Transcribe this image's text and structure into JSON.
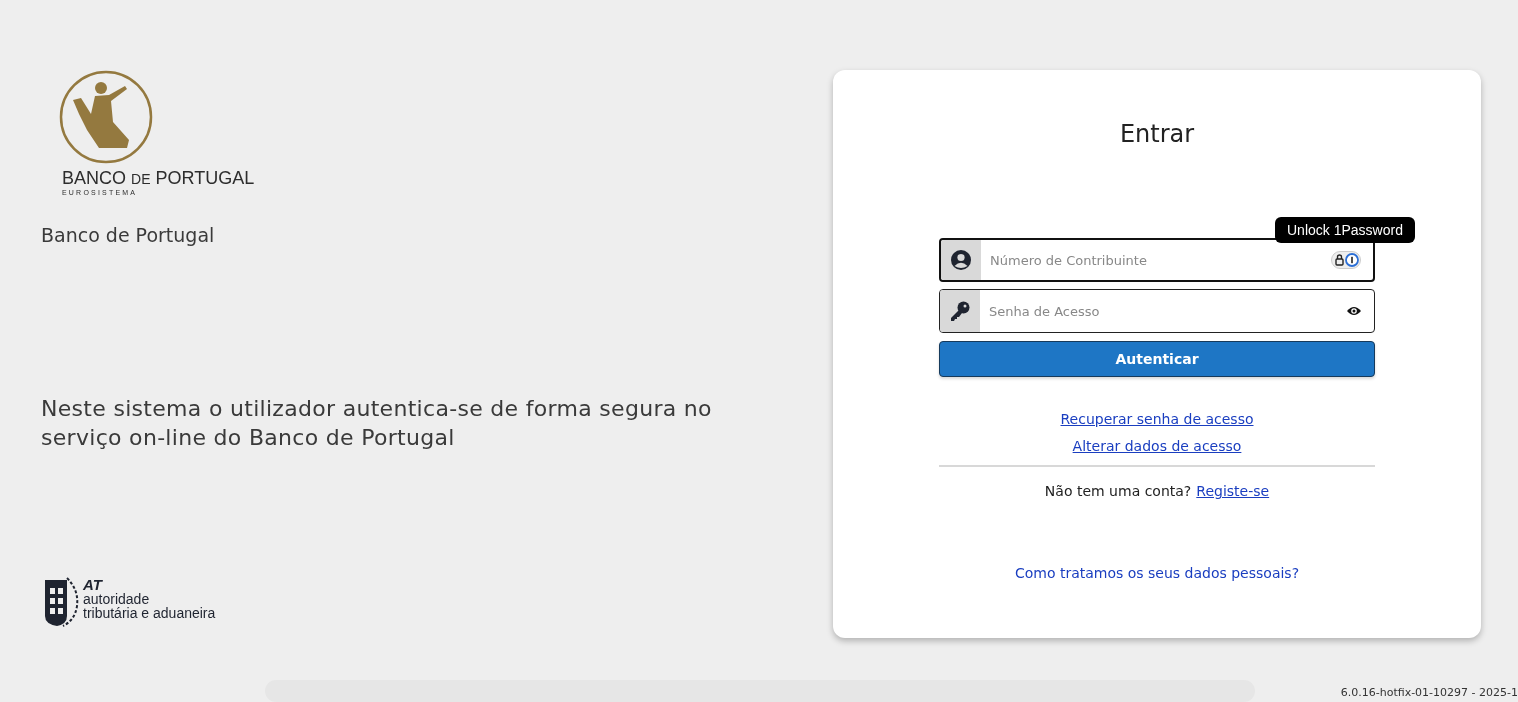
{
  "brand": {
    "logo_word_1": "BANCO",
    "logo_word_2": "DE",
    "logo_word_3": "PORTUGAL",
    "logo_subtitle": "EUROSISTEMA",
    "title": "Banco de Portugal"
  },
  "intro": "Neste sistema o utilizador autentica-se de forma segura no serviço on-line do Banco de Portugal",
  "partner_logo": {
    "abbr": "AT",
    "line_1": "autoridade",
    "line_2": "tributária e aduaneira"
  },
  "login": {
    "title": "Entrar",
    "fields": [
      {
        "kind": "user",
        "placeholder": "Número de Contribuinte",
        "focused": true
      },
      {
        "kind": "password",
        "placeholder": "Senha de Acesso",
        "focused": false
      }
    ],
    "tooltip": "Unlock 1Password",
    "submit": "Autenticar",
    "links": [
      "Recuperar senha de acesso",
      "Alterar dados de acesso"
    ],
    "signup_prompt": "Não tem uma conta?",
    "signup_link": "Registe-se",
    "privacy_link": "Como tratamos os seus dados pessoais?"
  },
  "version": "6.0.16-hotfix-01-10297 - 2025-1"
}
